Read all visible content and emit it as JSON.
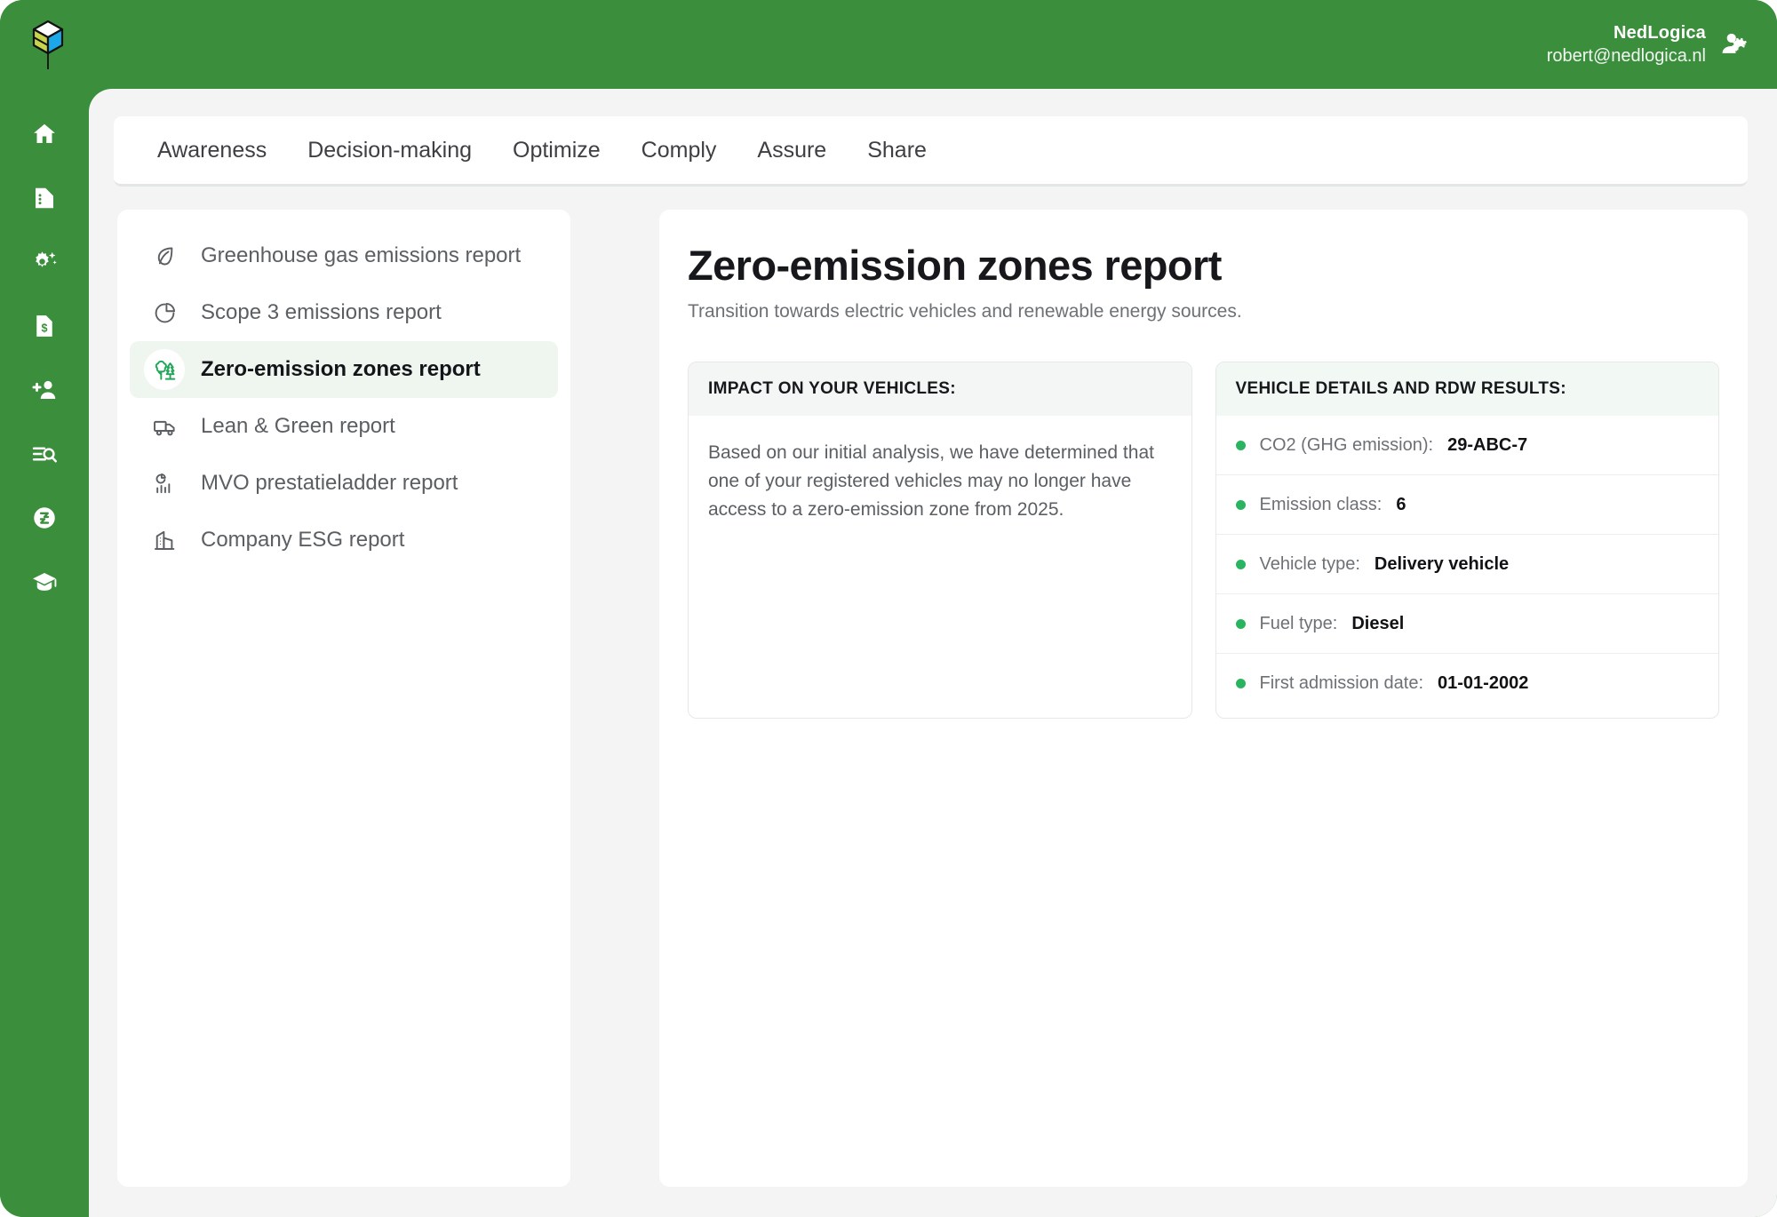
{
  "brand": {
    "logo_icon": "cube-logo-icon",
    "accent_green": "#3B8E3C",
    "dot_green": "#2BB45F"
  },
  "header": {
    "user_name": "NedLogica",
    "user_email": "robert@nedlogica.nl",
    "account_icon": "user-settings-icon"
  },
  "rail": {
    "items": [
      {
        "icon": "home-icon"
      },
      {
        "icon": "document-list-icon"
      },
      {
        "icon": "gear-sparkle-icon"
      },
      {
        "icon": "invoice-dollar-icon"
      },
      {
        "icon": "add-user-icon"
      },
      {
        "icon": "search-list-icon"
      },
      {
        "icon": "recycle-circle-icon"
      },
      {
        "icon": "graduation-cap-icon"
      }
    ]
  },
  "tabs": [
    {
      "label": "Awareness",
      "active": false
    },
    {
      "label": "Decision-making",
      "active": false
    },
    {
      "label": "Optimize",
      "active": false
    },
    {
      "label": "Comply",
      "active": false
    },
    {
      "label": "Assure",
      "active": false
    },
    {
      "label": "Share",
      "active": false
    }
  ],
  "report_list": [
    {
      "label": "Greenhouse gas emissions report",
      "icon": "leaf-icon",
      "active": false
    },
    {
      "label": "Scope 3 emissions report",
      "icon": "pie-chart-icon",
      "active": false
    },
    {
      "label": "Zero-emission zones report",
      "icon": "forest-trees-icon",
      "active": true
    },
    {
      "label": "Lean & Green report",
      "icon": "delivery-truck-icon",
      "active": false
    },
    {
      "label": "MVO prestatieladder report",
      "icon": "chart-bars-icon",
      "active": false
    },
    {
      "label": "Company ESG report",
      "icon": "office-building-icon",
      "active": false
    }
  ],
  "report": {
    "title": "Zero-emission zones report",
    "subtitle": "Transition towards electric vehicles and renewable energy sources."
  },
  "impact_card": {
    "heading": "IMPACT ON YOUR VEHICLES:",
    "body": "Based on our initial analysis, we have determined that one of your registered vehicles may no longer have access to a zero-emission zone from 2025."
  },
  "vehicle_card": {
    "heading": "VEHICLE DETAILS AND RDW RESULTS:",
    "rows": [
      {
        "label": "CO2 (GHG emission):",
        "value": "29-ABC-7"
      },
      {
        "label": "Emission class:",
        "value": "6"
      },
      {
        "label": "Vehicle type:",
        "value": "Delivery vehicle"
      },
      {
        "label": "Fuel type:",
        "value": "Diesel"
      },
      {
        "label": "First admission date:",
        "value": "01-01-2002"
      }
    ]
  }
}
